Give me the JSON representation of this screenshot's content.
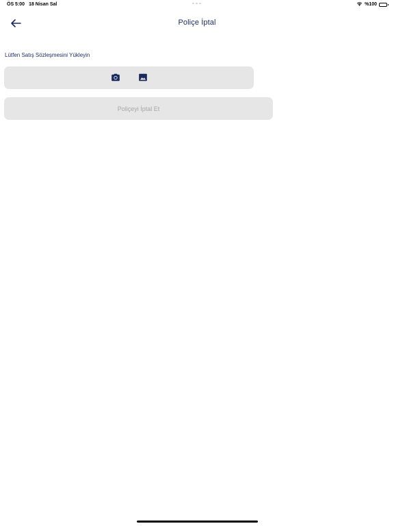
{
  "status_bar": {
    "time": "ÖS 5:00",
    "date": "18 Nisan Sal",
    "battery_text": "%100",
    "wifi_icon": "wifi-icon",
    "battery_icon": "battery-icon"
  },
  "nav": {
    "title": "Poliçe İptal",
    "back_icon": "arrow-left-icon"
  },
  "upload": {
    "label": "Lütfen Satış Sözleşmesini Yükleyin",
    "camera_icon": "camera-icon",
    "gallery_icon": "image-icon"
  },
  "actions": {
    "cancel_policy_label": "Poliçeyi İptal Et"
  },
  "colors": {
    "primary": "#1a2a5e",
    "field_bg": "#e6e6e6",
    "disabled_text": "#a7a7a7",
    "background": "#ffffff"
  }
}
